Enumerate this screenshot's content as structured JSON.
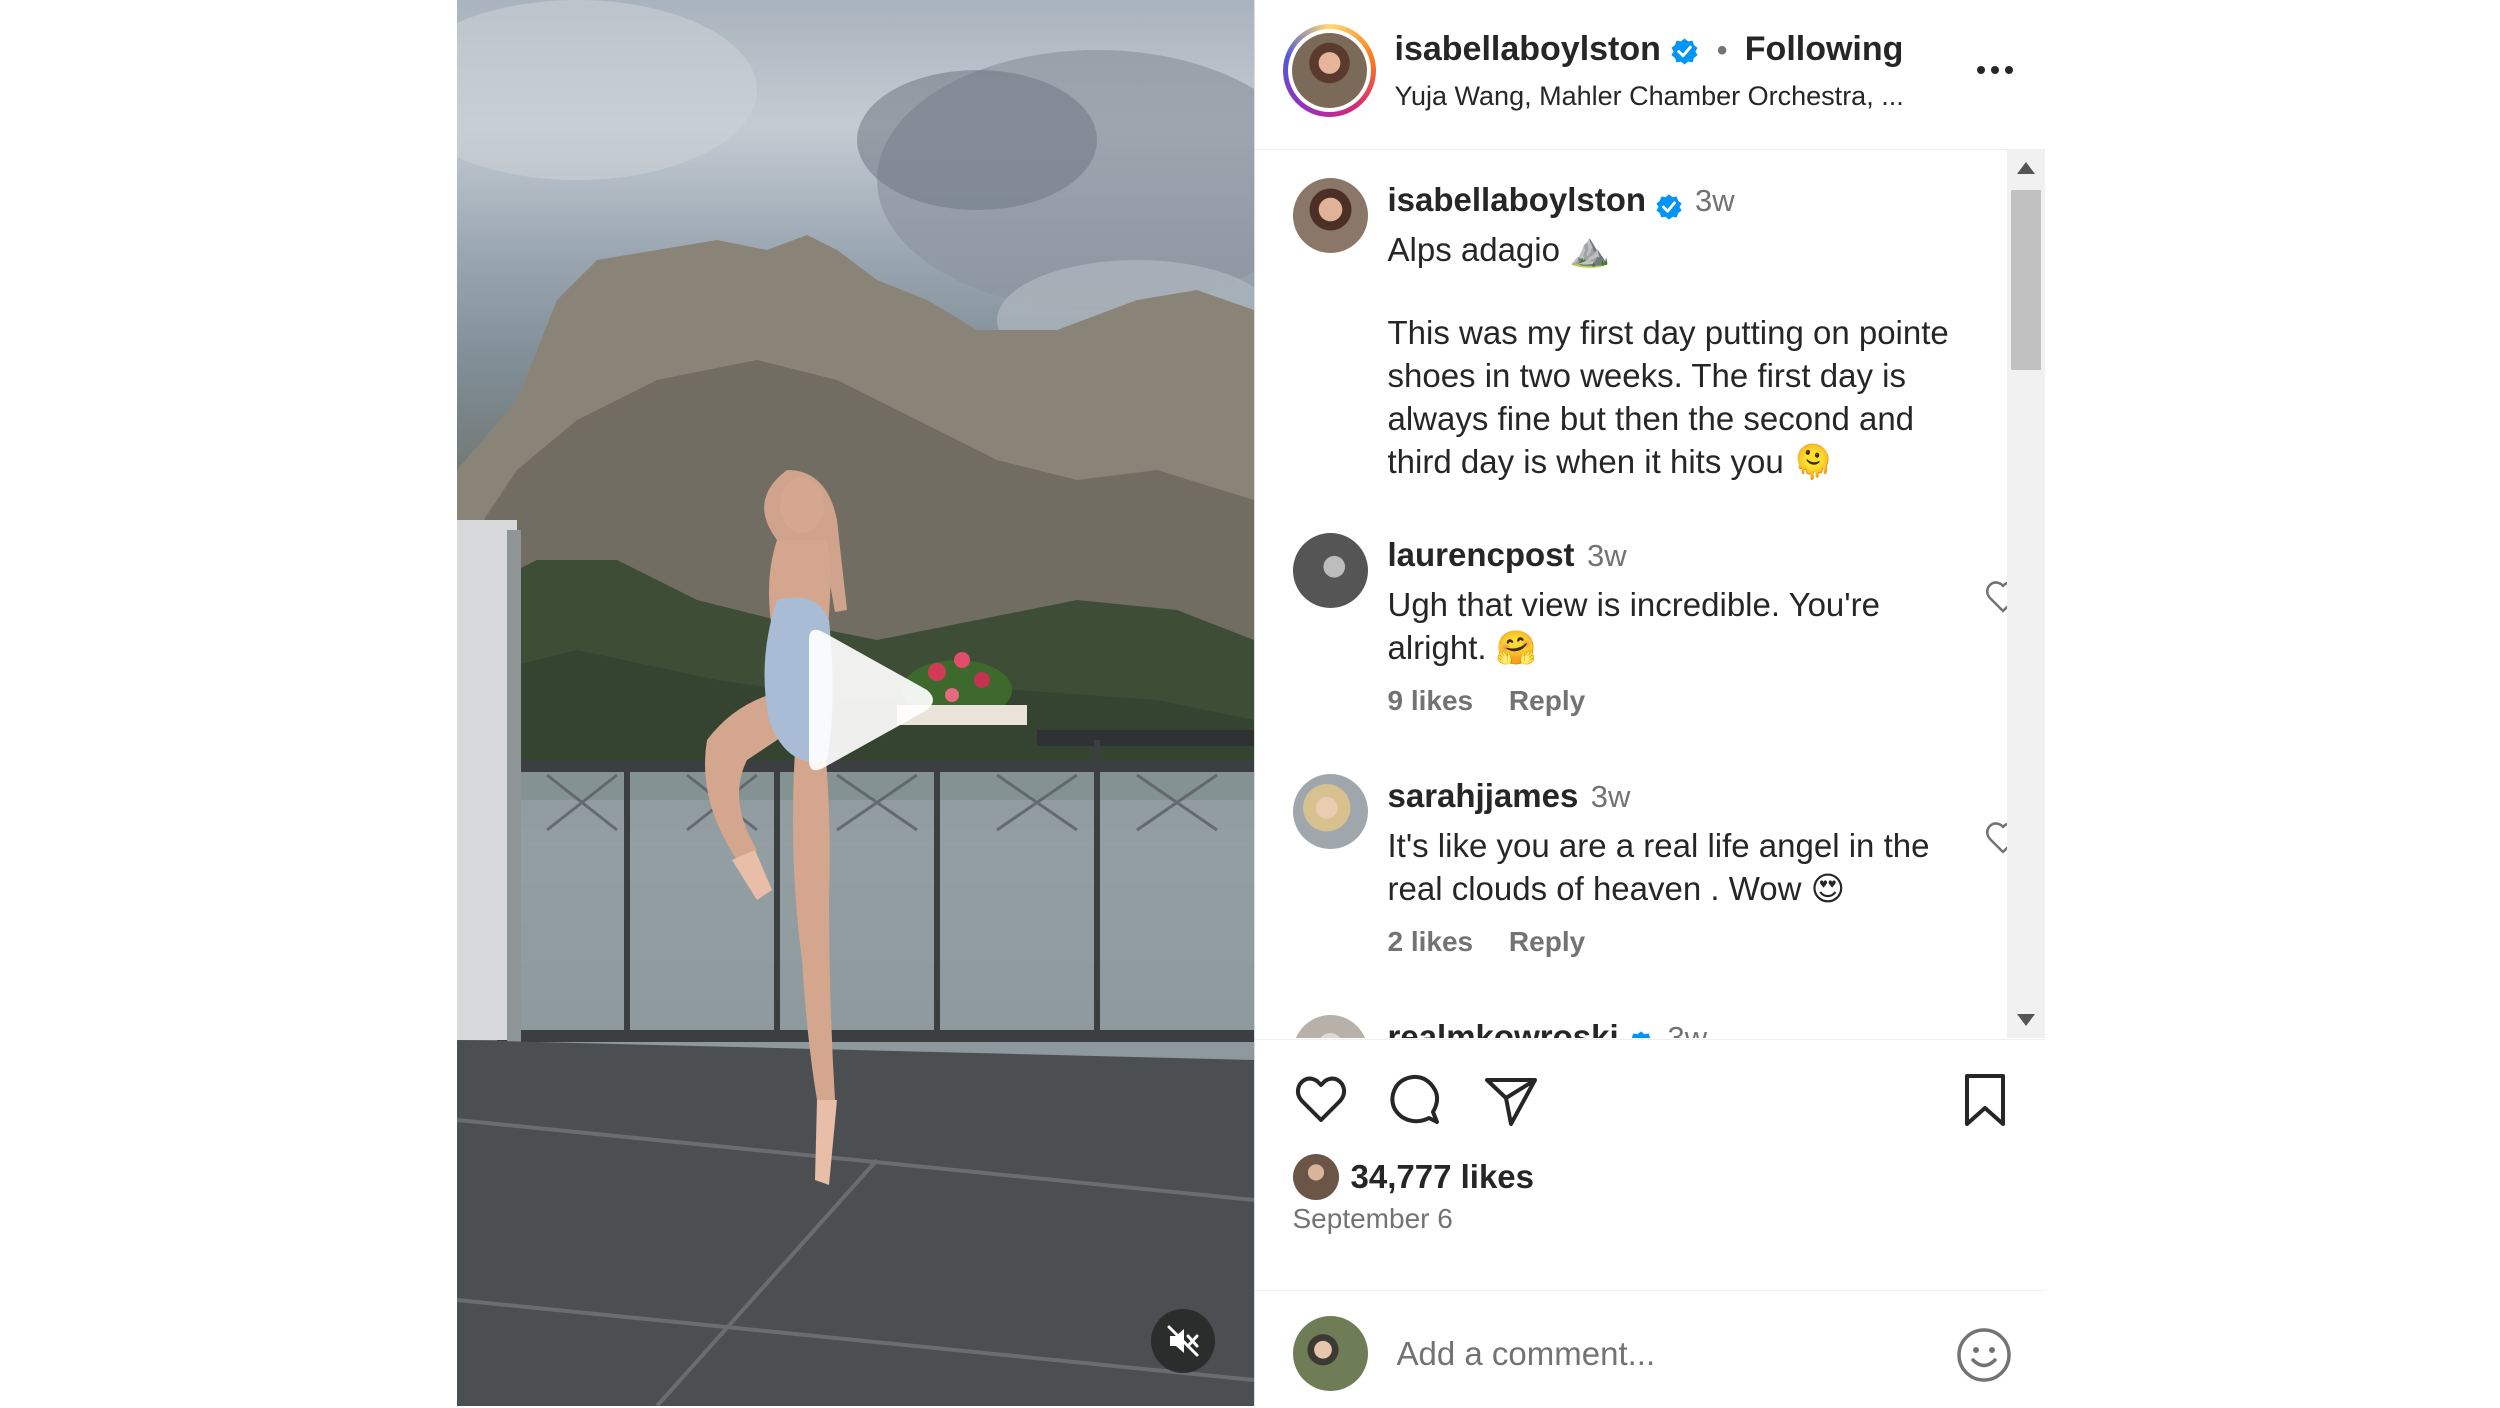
{
  "post": {
    "author": {
      "username": "isabellaboylston",
      "verified": true,
      "follow_status": "Following",
      "separator": "•",
      "audio_info": "Yuja Wang, Mahler Chamber Orchestra, ..."
    },
    "media": {
      "type": "video",
      "state": "paused",
      "muted": true,
      "play_icon": "play-icon",
      "mute_icon": "speaker-muted-icon"
    },
    "caption": {
      "username": "isabellaboylston",
      "verified": true,
      "time": "3w",
      "title": "Alps adagio ⛰️",
      "body": "This was my first day putting on pointe shoes in two weeks. The first day is always fine but then the second and third day is when it hits you 🫠"
    },
    "comments": [
      {
        "username": "laurencpost",
        "time": "3w",
        "text": "Ugh that view is incredible. You're alright. 🤗",
        "likes": "9 likes",
        "reply": "Reply"
      },
      {
        "username": "sarahjjames",
        "time": "3w",
        "text": "It's like you are a real life angel in the real clouds of heaven . Wow 😍",
        "likes": "2 likes",
        "reply": "Reply"
      },
      {
        "username": "realmkowroski",
        "time": "3w",
        "verified": true
      }
    ],
    "likes_count": "34,777 likes",
    "date": "September 6",
    "add_comment": {
      "placeholder": "Add a comment..."
    }
  },
  "colors": {
    "text": "#262626",
    "secondary": "#737373",
    "verified": "#0095f6",
    "border": "#dbdbdb"
  }
}
